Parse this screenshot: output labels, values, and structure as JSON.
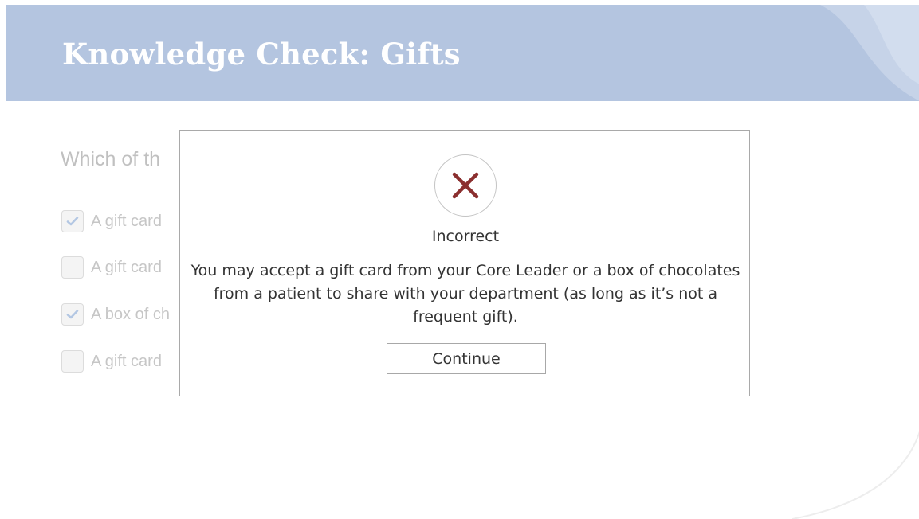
{
  "header": {
    "title": "Knowledge Check: Gifts",
    "background_color": "#b4c5e0"
  },
  "question": {
    "text": "Which of th"
  },
  "options": [
    {
      "label": "A gift card",
      "checked": true
    },
    {
      "label": "A gift card",
      "checked": false
    },
    {
      "label": "A box of ch",
      "checked": true
    },
    {
      "label": "A gift card",
      "checked": false
    }
  ],
  "feedback_dialog": {
    "icon": "close-icon",
    "icon_color": "#8b2f2f",
    "result": "Incorrect",
    "message": "You may accept a gift card from your Core Leader or a box of chocolates from a patient to share with your department (as long as it’s not a frequent gift).",
    "continue_label": "Continue"
  }
}
